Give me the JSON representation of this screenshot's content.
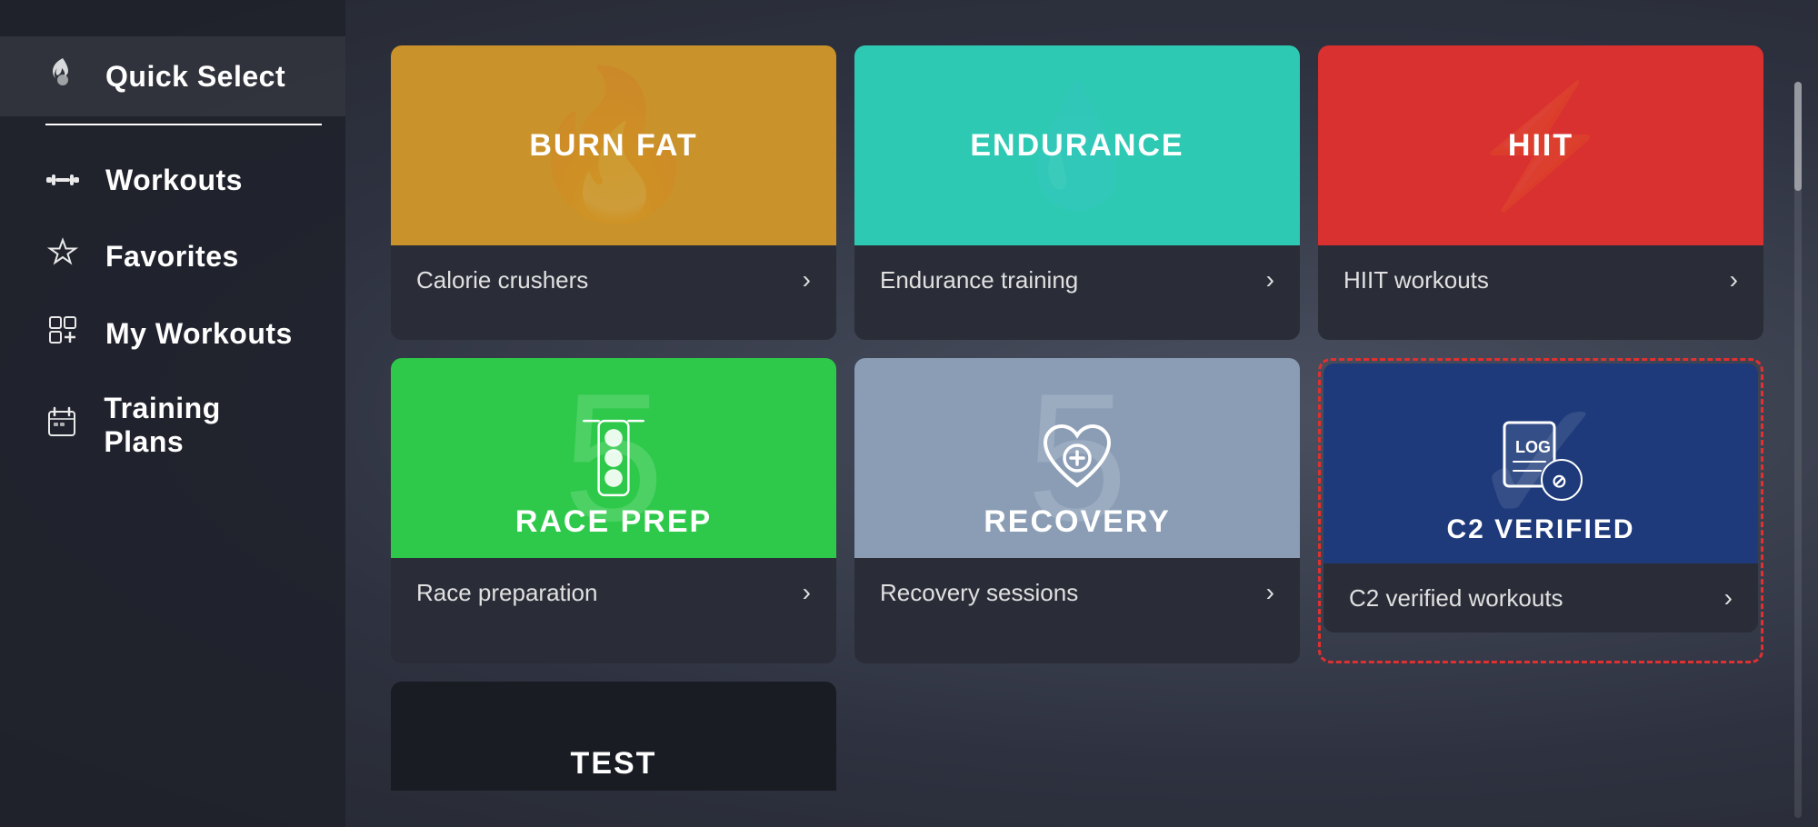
{
  "sidebar": {
    "items": [
      {
        "id": "quick-select",
        "label": "Quick Select",
        "icon": "🔥",
        "active": true
      },
      {
        "id": "workouts",
        "label": "Workouts",
        "icon": "🏋"
      },
      {
        "id": "favorites",
        "label": "Favorites",
        "icon": "☆"
      },
      {
        "id": "my-workouts",
        "label": "My Workouts",
        "icon": "⊞"
      },
      {
        "id": "training-plans",
        "label": "Training Plans",
        "icon": "📅"
      }
    ]
  },
  "grid": {
    "cards": [
      {
        "id": "burn-fat",
        "theme": "burn-fat",
        "title": "BURN FAT",
        "footer_label": "Calorie crushers",
        "footer_arrow": "›"
      },
      {
        "id": "endurance",
        "theme": "endurance",
        "title": "ENDURANCE",
        "footer_label": "Endurance training",
        "footer_arrow": "›"
      },
      {
        "id": "hiit",
        "theme": "hiit",
        "title": "HIIT",
        "footer_label": "HIIT workouts",
        "footer_arrow": "›"
      },
      {
        "id": "race-prep",
        "theme": "race-prep",
        "title": "RACE PREP",
        "footer_label": "Race preparation",
        "footer_arrow": "›"
      },
      {
        "id": "recovery",
        "theme": "recovery",
        "title": "RECOVERY",
        "footer_label": "Recovery sessions",
        "footer_arrow": "›"
      },
      {
        "id": "c2-verified",
        "theme": "c2-verified",
        "title": "C2 VERIFIED",
        "footer_label": "C2 verified workouts",
        "footer_arrow": "›",
        "highlighted": true
      }
    ],
    "partial_card": {
      "text": "TEST"
    }
  },
  "colors": {
    "burn_fat": "#c9922a",
    "endurance": "#2ec9b3",
    "hiit": "#d93030",
    "race_prep": "#2ec94a",
    "recovery": "#8a9db5",
    "c2_verified": "#1e3a7a",
    "highlight_border": "#e03030"
  }
}
